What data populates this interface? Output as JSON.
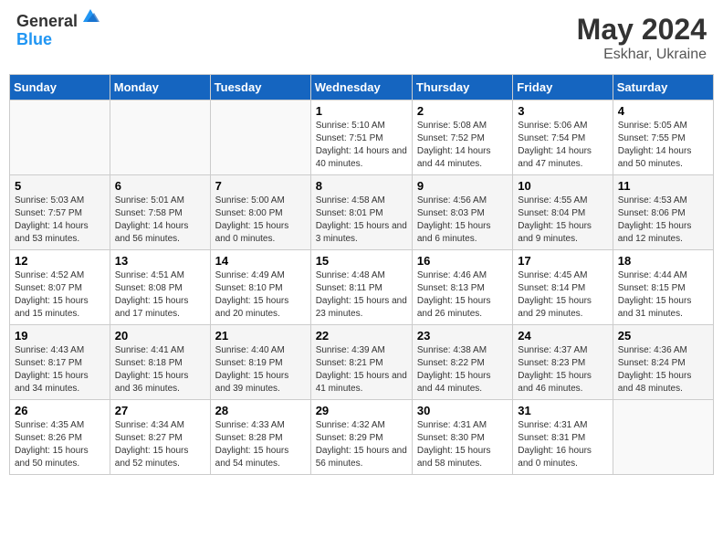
{
  "logo": {
    "general": "General",
    "blue": "Blue"
  },
  "title": {
    "month_year": "May 2024",
    "location": "Eskhar, Ukraine"
  },
  "days_of_week": [
    "Sunday",
    "Monday",
    "Tuesday",
    "Wednesday",
    "Thursday",
    "Friday",
    "Saturday"
  ],
  "weeks": [
    {
      "days": [
        {
          "num": "",
          "empty": true
        },
        {
          "num": "",
          "empty": true
        },
        {
          "num": "",
          "empty": true
        },
        {
          "num": "1",
          "sunrise": "5:10 AM",
          "sunset": "7:51 PM",
          "daylight": "14 hours and 40 minutes."
        },
        {
          "num": "2",
          "sunrise": "5:08 AM",
          "sunset": "7:52 PM",
          "daylight": "14 hours and 44 minutes."
        },
        {
          "num": "3",
          "sunrise": "5:06 AM",
          "sunset": "7:54 PM",
          "daylight": "14 hours and 47 minutes."
        },
        {
          "num": "4",
          "sunrise": "5:05 AM",
          "sunset": "7:55 PM",
          "daylight": "14 hours and 50 minutes."
        }
      ]
    },
    {
      "days": [
        {
          "num": "5",
          "sunrise": "5:03 AM",
          "sunset": "7:57 PM",
          "daylight": "14 hours and 53 minutes."
        },
        {
          "num": "6",
          "sunrise": "5:01 AM",
          "sunset": "7:58 PM",
          "daylight": "14 hours and 56 minutes."
        },
        {
          "num": "7",
          "sunrise": "5:00 AM",
          "sunset": "8:00 PM",
          "daylight": "15 hours and 0 minutes."
        },
        {
          "num": "8",
          "sunrise": "4:58 AM",
          "sunset": "8:01 PM",
          "daylight": "15 hours and 3 minutes."
        },
        {
          "num": "9",
          "sunrise": "4:56 AM",
          "sunset": "8:03 PM",
          "daylight": "15 hours and 6 minutes."
        },
        {
          "num": "10",
          "sunrise": "4:55 AM",
          "sunset": "8:04 PM",
          "daylight": "15 hours and 9 minutes."
        },
        {
          "num": "11",
          "sunrise": "4:53 AM",
          "sunset": "8:06 PM",
          "daylight": "15 hours and 12 minutes."
        }
      ]
    },
    {
      "days": [
        {
          "num": "12",
          "sunrise": "4:52 AM",
          "sunset": "8:07 PM",
          "daylight": "15 hours and 15 minutes."
        },
        {
          "num": "13",
          "sunrise": "4:51 AM",
          "sunset": "8:08 PM",
          "daylight": "15 hours and 17 minutes."
        },
        {
          "num": "14",
          "sunrise": "4:49 AM",
          "sunset": "8:10 PM",
          "daylight": "15 hours and 20 minutes."
        },
        {
          "num": "15",
          "sunrise": "4:48 AM",
          "sunset": "8:11 PM",
          "daylight": "15 hours and 23 minutes."
        },
        {
          "num": "16",
          "sunrise": "4:46 AM",
          "sunset": "8:13 PM",
          "daylight": "15 hours and 26 minutes."
        },
        {
          "num": "17",
          "sunrise": "4:45 AM",
          "sunset": "8:14 PM",
          "daylight": "15 hours and 29 minutes."
        },
        {
          "num": "18",
          "sunrise": "4:44 AM",
          "sunset": "8:15 PM",
          "daylight": "15 hours and 31 minutes."
        }
      ]
    },
    {
      "days": [
        {
          "num": "19",
          "sunrise": "4:43 AM",
          "sunset": "8:17 PM",
          "daylight": "15 hours and 34 minutes."
        },
        {
          "num": "20",
          "sunrise": "4:41 AM",
          "sunset": "8:18 PM",
          "daylight": "15 hours and 36 minutes."
        },
        {
          "num": "21",
          "sunrise": "4:40 AM",
          "sunset": "8:19 PM",
          "daylight": "15 hours and 39 minutes."
        },
        {
          "num": "22",
          "sunrise": "4:39 AM",
          "sunset": "8:21 PM",
          "daylight": "15 hours and 41 minutes."
        },
        {
          "num": "23",
          "sunrise": "4:38 AM",
          "sunset": "8:22 PM",
          "daylight": "15 hours and 44 minutes."
        },
        {
          "num": "24",
          "sunrise": "4:37 AM",
          "sunset": "8:23 PM",
          "daylight": "15 hours and 46 minutes."
        },
        {
          "num": "25",
          "sunrise": "4:36 AM",
          "sunset": "8:24 PM",
          "daylight": "15 hours and 48 minutes."
        }
      ]
    },
    {
      "days": [
        {
          "num": "26",
          "sunrise": "4:35 AM",
          "sunset": "8:26 PM",
          "daylight": "15 hours and 50 minutes."
        },
        {
          "num": "27",
          "sunrise": "4:34 AM",
          "sunset": "8:27 PM",
          "daylight": "15 hours and 52 minutes."
        },
        {
          "num": "28",
          "sunrise": "4:33 AM",
          "sunset": "8:28 PM",
          "daylight": "15 hours and 54 minutes."
        },
        {
          "num": "29",
          "sunrise": "4:32 AM",
          "sunset": "8:29 PM",
          "daylight": "15 hours and 56 minutes."
        },
        {
          "num": "30",
          "sunrise": "4:31 AM",
          "sunset": "8:30 PM",
          "daylight": "15 hours and 58 minutes."
        },
        {
          "num": "31",
          "sunrise": "4:31 AM",
          "sunset": "8:31 PM",
          "daylight": "16 hours and 0 minutes."
        },
        {
          "num": "",
          "empty": true
        }
      ]
    }
  ],
  "labels": {
    "sunrise": "Sunrise:",
    "sunset": "Sunset:",
    "daylight": "Daylight:"
  }
}
